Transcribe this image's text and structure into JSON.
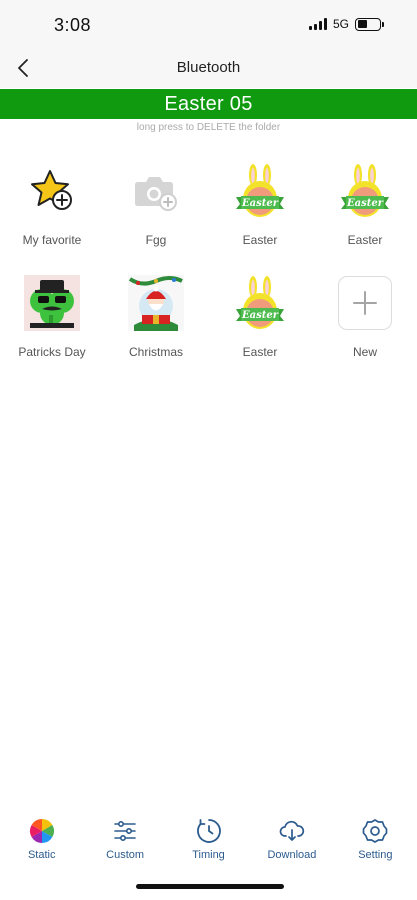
{
  "status_bar": {
    "time": "3:08",
    "network": "5G"
  },
  "nav": {
    "title": "Bluetooth"
  },
  "folder": {
    "name": "Easter 05",
    "hint": "long press to DELETE the folder"
  },
  "grid": [
    {
      "label": "My favorite",
      "icon": "star-add-icon"
    },
    {
      "label": "Fgg",
      "icon": "camera-add-icon"
    },
    {
      "label": "Easter",
      "icon": "easter-egg-image"
    },
    {
      "label": "Easter",
      "icon": "easter-egg-image"
    },
    {
      "label": "Patricks Day",
      "icon": "patricks-day-image"
    },
    {
      "label": "Christmas",
      "icon": "christmas-image"
    },
    {
      "label": "Easter",
      "icon": "easter-egg-image"
    },
    {
      "label": "New",
      "icon": "plus-icon"
    }
  ],
  "easter_image_text": "Easter",
  "tabs": [
    {
      "label": "Static",
      "icon": "color-wheel-icon"
    },
    {
      "label": "Custom",
      "icon": "sliders-icon"
    },
    {
      "label": "Timing",
      "icon": "timer-icon"
    },
    {
      "label": "Download",
      "icon": "cloud-download-icon"
    },
    {
      "label": "Setting",
      "icon": "gear-icon"
    }
  ],
  "colors": {
    "banner": "#109a10",
    "tab_text": "#2c5b8e",
    "star": "#f5c518"
  }
}
